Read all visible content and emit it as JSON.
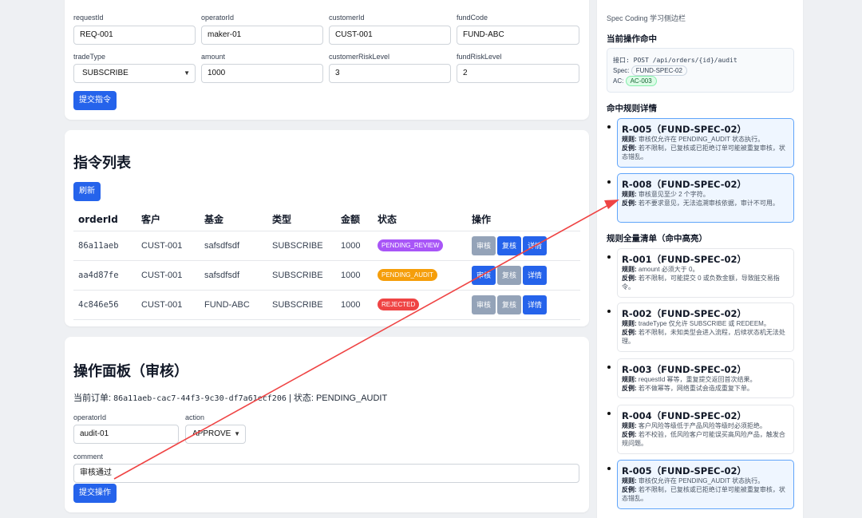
{
  "form": {
    "fields": [
      {
        "label": "requestId",
        "value": "REQ-001"
      },
      {
        "label": "operatorId",
        "value": "maker-01"
      },
      {
        "label": "customerId",
        "value": "CUST-001"
      },
      {
        "label": "fundCode",
        "value": "FUND-ABC"
      },
      {
        "label": "tradeType",
        "value": "SUBSCRIBE"
      },
      {
        "label": "amount",
        "value": "1000"
      },
      {
        "label": "customerRiskLevel",
        "value": "3"
      },
      {
        "label": "fundRiskLevel",
        "value": "2"
      }
    ],
    "submit_label": "提交指令"
  },
  "orders": {
    "title": "指令列表",
    "refresh_label": "刷新",
    "columns": [
      "orderId",
      "客户",
      "基金",
      "类型",
      "金额",
      "状态",
      "操作"
    ],
    "rows": [
      {
        "id": "86a11aeb",
        "customer": "CUST-001",
        "fund": "safsdfsdf",
        "type": "SUBSCRIBE",
        "amount": "1000",
        "status": "PENDING_REVIEW",
        "status_color": "#a855f7",
        "actions": [
          "审核",
          "复核",
          "详情"
        ]
      },
      {
        "id": "aa4d87fe",
        "customer": "CUST-001",
        "fund": "safsdfsdf",
        "type": "SUBSCRIBE",
        "amount": "1000",
        "status": "PENDING_AUDIT",
        "status_color": "#f59e0b",
        "actions": [
          "审核",
          "复核",
          "详情"
        ]
      },
      {
        "id": "4c846e56",
        "customer": "CUST-001",
        "fund": "FUND-ABC",
        "type": "SUBSCRIBE",
        "amount": "1000",
        "status": "REJECTED",
        "status_color": "#ef4444",
        "actions": [
          "审核",
          "复核",
          "详情"
        ]
      }
    ]
  },
  "panel": {
    "title": "操作面板（审核）",
    "current_prefix": "当前订单:",
    "current_order": "86a11aeb-cac7-44f3-9c30-df7a61ecf206",
    "status_text": "| 状态: PENDING_AUDIT",
    "operator_label": "operatorId",
    "operator_value": "audit-01",
    "action_label": "action",
    "action_value": "APPROVE",
    "comment_label": "comment",
    "comment_value": "审核通过",
    "submit_label": "提交操作"
  },
  "sidebar": {
    "subtitle": "Spec Coding 学习侧边栏",
    "current_title": "当前操作命中",
    "api_line": "接口: POST /api/orders/{id}/audit",
    "spec_label": "Spec:",
    "spec_value": "FUND-SPEC-02",
    "ac_label": "AC:",
    "ac_value": "AC-003",
    "hit_rules_title": "命中规则详情",
    "hit_rules": [
      {
        "title": "R-005（FUND-SPEC-02）",
        "rule": "审核仅允许在 PENDING_AUDIT 状态执行。",
        "counter": "若不限制，已复核或已拒绝订单可能被重复审核，状态错乱。"
      },
      {
        "title": "R-008（FUND-SPEC-02）",
        "rule": "审核意见至少 2 个字符。",
        "counter": "若不要求意见，无法追溯审核依据，审计不可用。"
      }
    ],
    "all_rules_title": "规则全量清单（命中高亮）",
    "all_rules": [
      {
        "title": "R-001（FUND-SPEC-02）",
        "rule": "amount 必须大于 0。",
        "counter": "若不限制，可能提交 0 或负数金额，导致脏交易指令。",
        "highlight": false
      },
      {
        "title": "R-002（FUND-SPEC-02）",
        "rule": "tradeType 仅允许 SUBSCRIBE 或 REDEEM。",
        "counter": "若不限制，未知类型会进入流程，后续状态机无法处理。",
        "highlight": false
      },
      {
        "title": "R-003（FUND-SPEC-02）",
        "rule": "requestId 幂等，重复提交返回首次结果。",
        "counter": "若不做幂等，网络重试会造成重复下单。",
        "highlight": false
      },
      {
        "title": "R-004（FUND-SPEC-02）",
        "rule": "客户风险等级低于产品风险等级时必须拒绝。",
        "counter": "若不校验，低风险客户可能误买高风险产品，触发合规问题。",
        "highlight": false
      },
      {
        "title": "R-005（FUND-SPEC-02）",
        "rule": "审核仅允许在 PENDING_AUDIT 状态执行。",
        "counter": "若不限制，已复核或已拒绝订单可能被重复审核，状态错乱。",
        "highlight": true
      }
    ],
    "rule_prefix": "规则:",
    "counter_prefix": "反例:"
  },
  "colors": {
    "primary": "#2563eb",
    "annotation_arrow": "#ef4444"
  }
}
